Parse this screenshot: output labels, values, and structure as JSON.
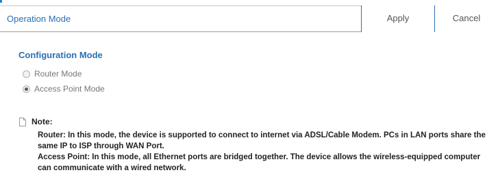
{
  "header": {
    "title": "Operation Mode",
    "apply_label": "Apply",
    "cancel_label": "Cancel"
  },
  "config": {
    "section_title": "Configuration Mode",
    "options": [
      {
        "label": "Router Mode",
        "selected": false
      },
      {
        "label": "Access Point Mode",
        "selected": true
      }
    ]
  },
  "note": {
    "label": "Note:",
    "router_text": "Router: In this mode, the device is supported to connect to internet via ADSL/Cable Modem. PCs in LAN ports share the same IP to ISP through WAN Port.",
    "ap_text": "Access Point: In this mode, all Ethernet ports are bridged together. The device allows the wireless-equipped computer can communicate with a wired network."
  },
  "colors": {
    "accent": "#2a6fb5",
    "text_muted": "#777777",
    "text_dark": "#222222"
  },
  "icons": {
    "note": "document-icon",
    "radio_unselected": "radio-unchecked-icon",
    "radio_selected": "radio-checked-icon"
  }
}
